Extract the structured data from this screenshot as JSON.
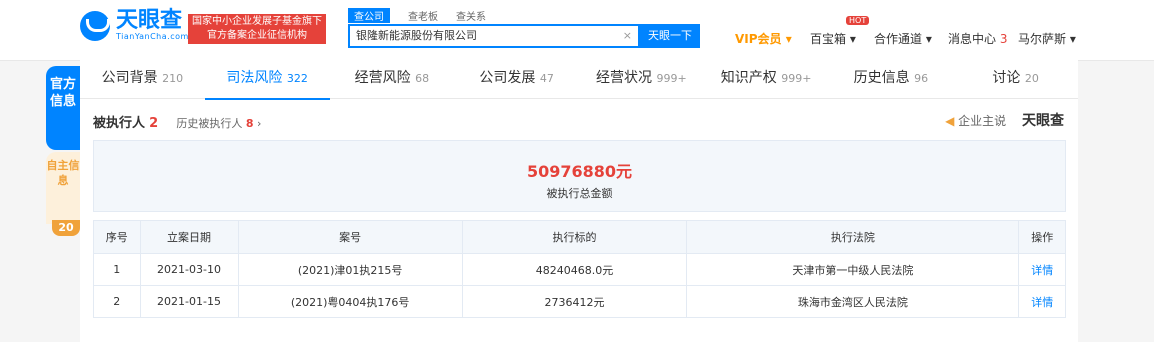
{
  "header": {
    "logo_cn": "天眼查",
    "logo_en": "TianYanCha.com",
    "promo_line1": "国家中小企业发展子基金旗下",
    "promo_line2": "官方备案企业征信机构",
    "search_tabs": [
      "查公司",
      "查老板",
      "查关系"
    ],
    "search_value": "银隆新能源股份有限公司",
    "search_clear": "×",
    "search_button": "天眼一下",
    "vip": "VIP会员",
    "treasure": "百宝箱",
    "hot": "HOT",
    "cooperation": "合作通道",
    "messages": "消息中心",
    "messages_count": "3",
    "user": "马尔萨斯"
  },
  "side": {
    "tab1": "官方信息",
    "tab2": "自主信息",
    "tab2_count": "20"
  },
  "tabs": [
    {
      "label": "公司背景",
      "count": "210"
    },
    {
      "label": "司法风险",
      "count": "322"
    },
    {
      "label": "经营风险",
      "count": "68"
    },
    {
      "label": "公司发展",
      "count": "47"
    },
    {
      "label": "经营状况",
      "count": "999+"
    },
    {
      "label": "知识产权",
      "count": "999+"
    },
    {
      "label": "历史信息",
      "count": "96"
    },
    {
      "label": "讨论",
      "count": "20"
    }
  ],
  "section": {
    "title": "被执行人",
    "count": "2",
    "history_label": "历史被执行人",
    "history_count": "8",
    "advertise": "企业主说",
    "brand": "天眼查"
  },
  "summary": {
    "amount": "50976880元",
    "label": "被执行总金额"
  },
  "table": {
    "headers": [
      "序号",
      "立案日期",
      "案号",
      "执行标的",
      "执行法院",
      "操作"
    ],
    "rows": [
      [
        "1",
        "2021-03-10",
        "(2021)津01执215号",
        "48240468.0元",
        "天津市第一中级人民法院",
        "详情"
      ],
      [
        "2",
        "2021-01-15",
        "(2021)粤0404执176号",
        "2736412元",
        "珠海市金湾区人民法院",
        "详情"
      ]
    ]
  }
}
